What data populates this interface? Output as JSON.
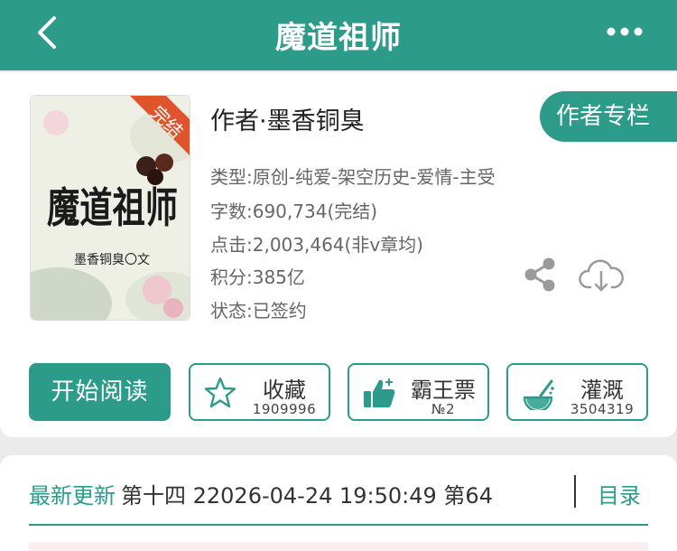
{
  "header": {
    "title": "魔道祖师",
    "back_icon": "chevron-left-icon",
    "more_icon": "more-dots-icon",
    "bg_color": "#2c9b8a"
  },
  "book": {
    "cover": {
      "ribbon": "完结",
      "title_art": "魔道祖师",
      "author_line": "墨香铜臭〇文"
    },
    "author": "作者·墨香铜臭",
    "author_column_button": "作者专栏",
    "meta": {
      "type": "类型:原创-纯爱-架空历史-爱情-主受",
      "word_count": "字数:690,734(完结)",
      "clicks": "点击:2,003,464(非v章均)",
      "score": "积分:385亿",
      "status": "状态:已签约"
    }
  },
  "actions": {
    "read": "开始阅读",
    "favorite": {
      "label": "收藏",
      "count": "1909996",
      "icon": "star-icon"
    },
    "ticket": {
      "label": "霸王票",
      "count": "№2",
      "icon": "thumbs-up-icon"
    },
    "irrigate": {
      "label": "灌溉",
      "count": "3504319",
      "icon": "watering-icon"
    }
  },
  "update": {
    "label": "最新更新",
    "text": "第十四 22026-04-24 19:50:49  第64",
    "toc": "目录"
  }
}
